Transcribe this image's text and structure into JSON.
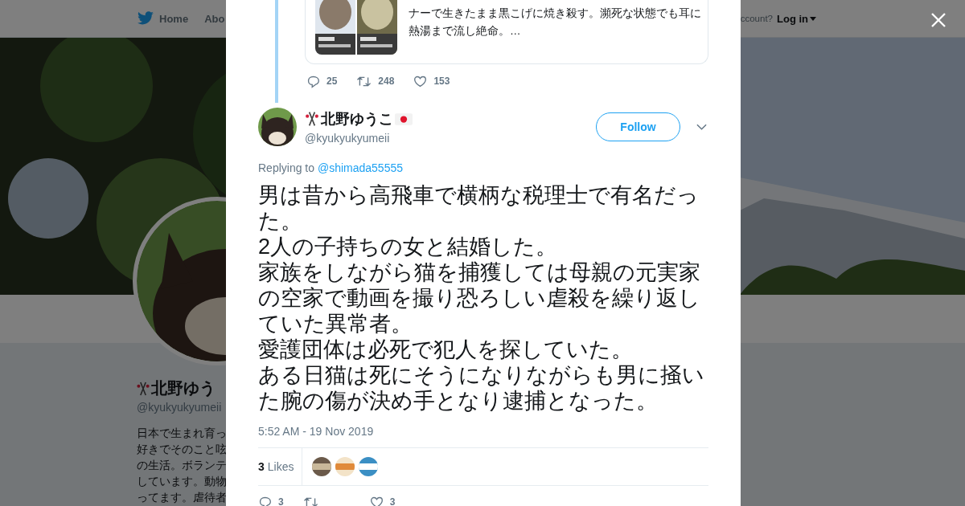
{
  "background_page": {
    "nav": [
      {
        "label": "Home"
      },
      {
        "label": "Abo"
      }
    ],
    "login_prompt": "ccount?",
    "login": "Log in",
    "profile": {
      "name": "北野ゆう",
      "handle": "@kyukyukyumeii",
      "bio_lines": [
        "日本で生まれ育っ",
        "好きでそのこと呟",
        "の生活。ボランテ",
        "しています。動物",
        "ってます。虐待者"
      ]
    }
  },
  "quoted_tweet": {
    "text_lines": [
      "ナーで生きたまま黒こげに焼き殺す。瀕死な状態でも耳に",
      "熱湯まで流し絶命。…"
    ],
    "media": [
      {
        "kind": "picture"
      },
      {
        "kind": "picture"
      }
    ]
  },
  "parent_actions": {
    "replies": "25",
    "retweets": "248",
    "likes": "153"
  },
  "tweet": {
    "name": "北野ゆうこ",
    "handle": "@kyukyukyumeii",
    "follow": "Follow",
    "replying_label": "Replying to",
    "replying_to": "@shimada55555",
    "text_paragraphs": [
      "男は昔から高飛車で横柄な税理士で有名だった。",
      "2人の子持ちの女と結婚した。",
      "家族をしながら猫を捕獲しては母親の元実家の空家で動画を撮り恐ろしい虐殺を繰り返していた異常者。",
      "愛護団体は必死で犯人を探していた。",
      "ある日猫は死にそうになりながらも男に掻いた腕の傷が決め手となり逮捕となった。"
    ],
    "timestamp": "5:52 AM - 19 Nov 2019",
    "likes_count": "3",
    "likes_label": "Likes",
    "likers": [
      {
        "kind": "picture"
      },
      {
        "kind": "picture"
      },
      {
        "kind": "picture"
      }
    ],
    "actions": {
      "replies": "3",
      "likes": "3"
    }
  }
}
